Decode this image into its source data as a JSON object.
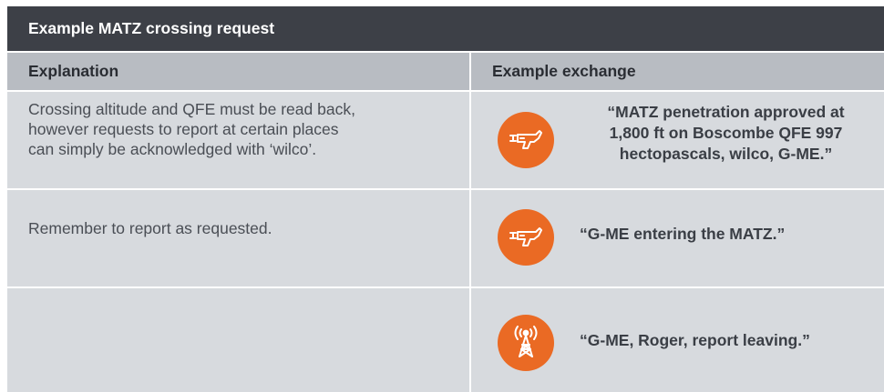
{
  "title": "Example MATZ crossing request",
  "headers": {
    "explanation": "Explanation",
    "exchange": "Example exchange"
  },
  "rows": [
    {
      "explanation_lines": [
        "Crossing altitude and QFE must be read back,",
        "however requests to report at certain places",
        "can simply be acknowledged with ‘wilco’."
      ],
      "icon": "aircraft-icon",
      "exchange_lines": [
        "“MATZ penetration approved at",
        "1,800 ft on Boscombe QFE 997",
        "hectopascals, wilco, G-ME.”"
      ]
    },
    {
      "explanation_lines": [
        "Remember to report as requested."
      ],
      "icon": "aircraft-icon",
      "exchange_lines": [
        "“G-ME entering the MATZ.”"
      ]
    },
    {
      "explanation_lines": [],
      "icon": "radio-tower-icon",
      "exchange_lines": [
        "“G-ME, Roger, report leaving.”"
      ]
    }
  ],
  "colors": {
    "title_bg": "#3d4047",
    "header_bg": "#b8bcc2",
    "cell_bg": "#d7dade",
    "icon_bg": "#ea6a24"
  }
}
